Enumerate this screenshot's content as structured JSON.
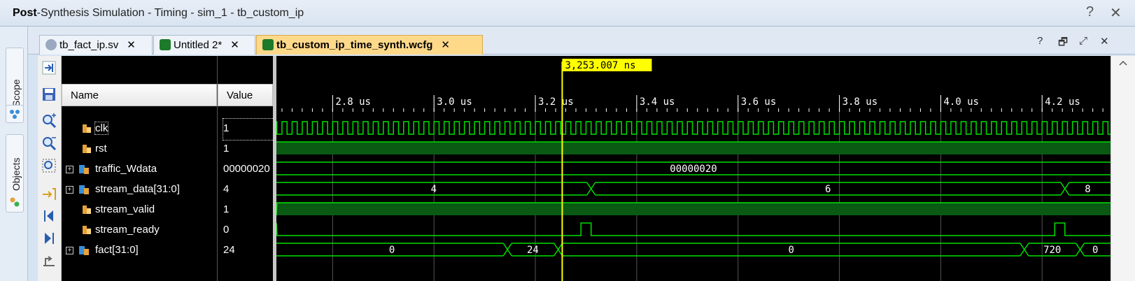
{
  "window": {
    "title_bold": "Post",
    "title_rest": "-Synthesis Simulation - Timing - sim_1 - tb_custom_ip",
    "help": "?",
    "close": "✕"
  },
  "side_tabs": [
    {
      "label": "Scope",
      "icon": "scope-icon"
    },
    {
      "label": "Objects",
      "icon": "objects-icon"
    }
  ],
  "tabs": [
    {
      "label": "tb_fact_ip.sv",
      "icon": "sv-file-icon",
      "active": false
    },
    {
      "label": "Untitled 2*",
      "icon": "waveform-icon",
      "active": false
    },
    {
      "label": "tb_custom_ip_time_synth.wcfg",
      "icon": "waveform-icon",
      "active": true
    }
  ],
  "tab_close": "✕",
  "pane_controls": {
    "help": "?",
    "restore": "🗗",
    "float": "⤢",
    "close": "✕"
  },
  "columns": {
    "name": "Name",
    "value": "Value"
  },
  "signals": [
    {
      "name": "clk",
      "value": "1",
      "kind": "bit",
      "expandable": false
    },
    {
      "name": "rst",
      "value": "1",
      "kind": "bit",
      "expandable": false
    },
    {
      "name": "traffic_Wdata",
      "value": "00000020",
      "kind": "bus",
      "expandable": true
    },
    {
      "name": "stream_data[31:0]",
      "value": "4",
      "kind": "bus",
      "expandable": true
    },
    {
      "name": "stream_valid",
      "value": "1",
      "kind": "bit",
      "expandable": false
    },
    {
      "name": "stream_ready",
      "value": "0",
      "kind": "bit",
      "expandable": false
    },
    {
      "name": "fact[31:0]",
      "value": "24",
      "kind": "bus",
      "expandable": true
    }
  ],
  "cursor_label": "3,253.007 ns",
  "time_ruler": {
    "ticks": [
      "2.8 us",
      "3.0 us",
      "3.2 us",
      "3.4 us",
      "3.6 us",
      "3.8 us",
      "4.0 us",
      "4.2 us"
    ],
    "view_start_ns": 2689,
    "view_end_ns": 4335,
    "cursor_ns": 3253.007
  },
  "waves": {
    "clk_period_ns": 20,
    "rst_level": 1,
    "traffic_Wdata": [
      {
        "from": 2689,
        "to": 4335,
        "label": "00000020"
      }
    ],
    "stream_data": [
      {
        "from": 2689,
        "to": 3310,
        "label": "4"
      },
      {
        "from": 3310,
        "to": 4245,
        "label": "6"
      },
      {
        "from": 4245,
        "to": 4335,
        "label": "8"
      }
    ],
    "stream_valid_from_ns": 2689,
    "stream_ready_pulses": [
      {
        "from": 3290,
        "to": 3310
      },
      {
        "from": 4225,
        "to": 4245
      }
    ],
    "fact": [
      {
        "from": 2689,
        "to": 3145,
        "label": "0"
      },
      {
        "from": 3145,
        "to": 3245,
        "label": "24"
      },
      {
        "from": 3245,
        "to": 4165,
        "label": "0"
      },
      {
        "from": 4165,
        "to": 4275,
        "label": "720"
      },
      {
        "from": 4275,
        "to": 4335,
        "label": "0"
      }
    ]
  },
  "colors": {
    "wave": "#00e000",
    "wave_fill": "#0a5a14",
    "cursor": "#ffff00",
    "active_tab": "#ffd98a"
  }
}
